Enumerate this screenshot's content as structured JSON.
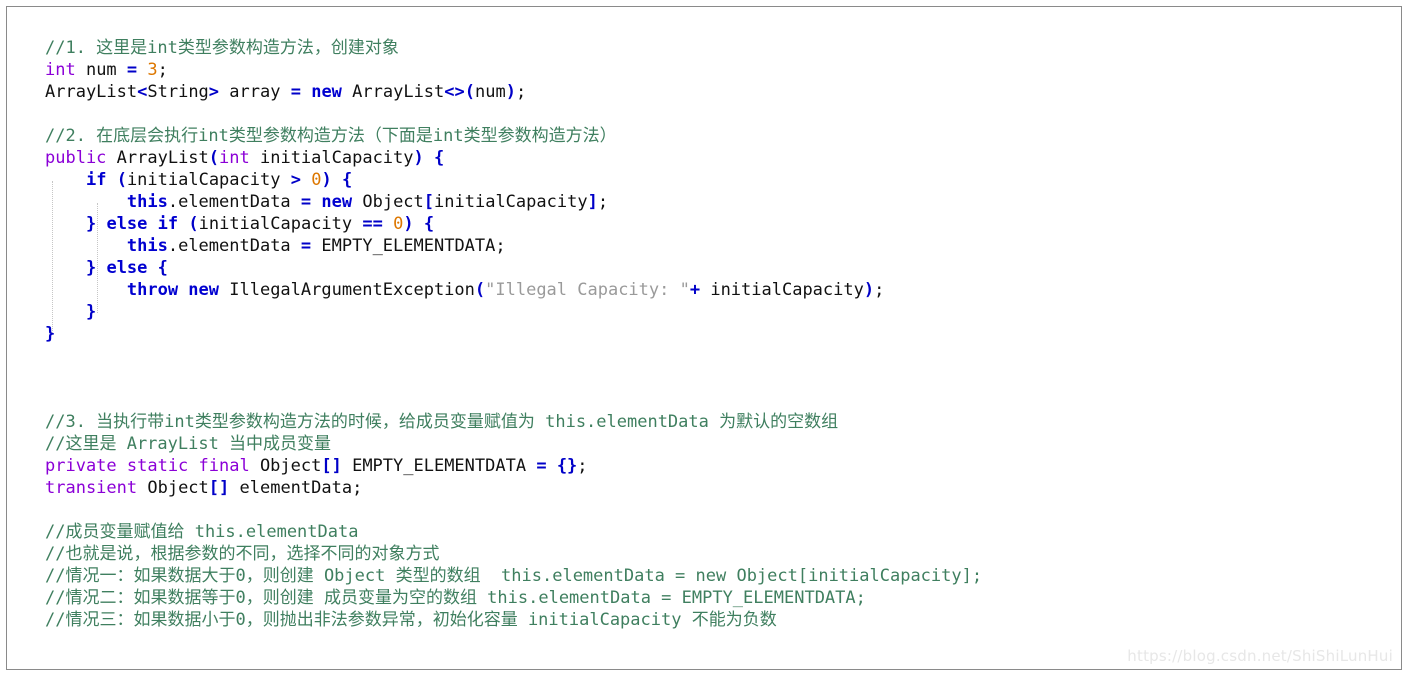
{
  "window": {
    "background_color": "#ffffff",
    "border_color": "#8a8a8a"
  },
  "syntax_colors": {
    "comment": "#3f7f5f",
    "keyword_purple": "#8b00d7",
    "keyword_blue_bold": "#0000d0",
    "number": "#dd7700",
    "string": "#9a9a9a",
    "operator": "#0000c8",
    "plain": "#111111"
  },
  "watermark": {
    "text": "https://blog.csdn.net/ShiShiLunHui",
    "color": "#e7e7e7"
  },
  "code": {
    "language": "java",
    "lines": [
      {
        "id": "l1",
        "tokens": [
          {
            "t": "//1. 这里是int类型参数构造方法，创建对象",
            "c": "cmt"
          }
        ]
      },
      {
        "id": "l2",
        "tokens": [
          {
            "t": "int",
            "c": "kwp"
          },
          {
            "t": " num ",
            "c": "pln"
          },
          {
            "t": "=",
            "c": "op"
          },
          {
            "t": " ",
            "c": "pln"
          },
          {
            "t": "3",
            "c": "num"
          },
          {
            "t": ";",
            "c": "pln"
          }
        ]
      },
      {
        "id": "l3",
        "tokens": [
          {
            "t": "ArrayList",
            "c": "pln"
          },
          {
            "t": "<",
            "c": "brk"
          },
          {
            "t": "String",
            "c": "pln"
          },
          {
            "t": ">",
            "c": "brk"
          },
          {
            "t": " array ",
            "c": "pln"
          },
          {
            "t": "=",
            "c": "op"
          },
          {
            "t": " ",
            "c": "pln"
          },
          {
            "t": "new",
            "c": "kwb"
          },
          {
            "t": " ArrayList",
            "c": "pln"
          },
          {
            "t": "<>(",
            "c": "brk"
          },
          {
            "t": "num",
            "c": "pln"
          },
          {
            "t": ")",
            "c": "brk"
          },
          {
            "t": ";",
            "c": "pln"
          }
        ]
      },
      {
        "id": "l4",
        "tokens": []
      },
      {
        "id": "l5",
        "tokens": [
          {
            "t": "//2. 在底层会执行int类型参数构造方法（下面是int类型参数构造方法）",
            "c": "cmt"
          }
        ]
      },
      {
        "id": "l6",
        "tokens": [
          {
            "t": "public",
            "c": "kwp"
          },
          {
            "t": " ArrayList",
            "c": "pln"
          },
          {
            "t": "(",
            "c": "brk"
          },
          {
            "t": "int",
            "c": "kwp"
          },
          {
            "t": " initialCapacity",
            "c": "pln"
          },
          {
            "t": ")",
            "c": "brk"
          },
          {
            "t": " ",
            "c": "pln"
          },
          {
            "t": "{",
            "c": "brk"
          }
        ]
      },
      {
        "id": "l7",
        "tokens": [
          {
            "t": "    ",
            "c": "pln"
          },
          {
            "t": "if",
            "c": "kwb"
          },
          {
            "t": " ",
            "c": "pln"
          },
          {
            "t": "(",
            "c": "brk"
          },
          {
            "t": "initialCapacity ",
            "c": "pln"
          },
          {
            "t": ">",
            "c": "op"
          },
          {
            "t": " ",
            "c": "pln"
          },
          {
            "t": "0",
            "c": "num"
          },
          {
            "t": ")",
            "c": "brk"
          },
          {
            "t": " ",
            "c": "pln"
          },
          {
            "t": "{",
            "c": "brk"
          }
        ]
      },
      {
        "id": "l8",
        "tokens": [
          {
            "t": "        ",
            "c": "pln"
          },
          {
            "t": "this",
            "c": "kwb"
          },
          {
            "t": ".elementData ",
            "c": "pln"
          },
          {
            "t": "=",
            "c": "op"
          },
          {
            "t": " ",
            "c": "pln"
          },
          {
            "t": "new",
            "c": "kwb"
          },
          {
            "t": " Object",
            "c": "pln"
          },
          {
            "t": "[",
            "c": "brk"
          },
          {
            "t": "initialCapacity",
            "c": "pln"
          },
          {
            "t": "]",
            "c": "brk"
          },
          {
            "t": ";",
            "c": "pln"
          }
        ]
      },
      {
        "id": "l9",
        "tokens": [
          {
            "t": "    ",
            "c": "pln"
          },
          {
            "t": "}",
            "c": "brk"
          },
          {
            "t": " ",
            "c": "pln"
          },
          {
            "t": "else if",
            "c": "kwb"
          },
          {
            "t": " ",
            "c": "pln"
          },
          {
            "t": "(",
            "c": "brk"
          },
          {
            "t": "initialCapacity ",
            "c": "pln"
          },
          {
            "t": "==",
            "c": "op"
          },
          {
            "t": " ",
            "c": "pln"
          },
          {
            "t": "0",
            "c": "num"
          },
          {
            "t": ")",
            "c": "brk"
          },
          {
            "t": " ",
            "c": "pln"
          },
          {
            "t": "{",
            "c": "brk"
          }
        ]
      },
      {
        "id": "l10",
        "tokens": [
          {
            "t": "        ",
            "c": "pln"
          },
          {
            "t": "this",
            "c": "kwb"
          },
          {
            "t": ".elementData ",
            "c": "pln"
          },
          {
            "t": "=",
            "c": "op"
          },
          {
            "t": " EMPTY_ELEMENTDATA;",
            "c": "pln"
          }
        ]
      },
      {
        "id": "l11",
        "tokens": [
          {
            "t": "    ",
            "c": "pln"
          },
          {
            "t": "}",
            "c": "brk"
          },
          {
            "t": " ",
            "c": "pln"
          },
          {
            "t": "else",
            "c": "kwb"
          },
          {
            "t": " ",
            "c": "pln"
          },
          {
            "t": "{",
            "c": "brk"
          }
        ]
      },
      {
        "id": "l12",
        "tokens": [
          {
            "t": "        ",
            "c": "pln"
          },
          {
            "t": "throw new",
            "c": "kwb"
          },
          {
            "t": " IllegalArgumentException",
            "c": "pln"
          },
          {
            "t": "(",
            "c": "brk"
          },
          {
            "t": "\"Illegal Capacity: \"",
            "c": "str"
          },
          {
            "t": "+",
            "c": "op"
          },
          {
            "t": " initialCapacity",
            "c": "pln"
          },
          {
            "t": ")",
            "c": "brk"
          },
          {
            "t": ";",
            "c": "pln"
          }
        ]
      },
      {
        "id": "l13",
        "tokens": [
          {
            "t": "    ",
            "c": "pln"
          },
          {
            "t": "}",
            "c": "brk"
          }
        ]
      },
      {
        "id": "l14",
        "tokens": [
          {
            "t": "}",
            "c": "brk"
          }
        ]
      },
      {
        "id": "l15",
        "tokens": []
      },
      {
        "id": "l16",
        "tokens": []
      },
      {
        "id": "l17",
        "tokens": []
      },
      {
        "id": "l18",
        "tokens": [
          {
            "t": "//3. 当执行带int类型参数构造方法的时候，给成员变量赋值为 this.elementData 为默认的空数组",
            "c": "cmt"
          }
        ]
      },
      {
        "id": "l19",
        "tokens": [
          {
            "t": "//这里是 ArrayList 当中成员变量",
            "c": "cmt"
          }
        ]
      },
      {
        "id": "l20",
        "tokens": [
          {
            "t": "private static final",
            "c": "kwp"
          },
          {
            "t": " Object",
            "c": "pln"
          },
          {
            "t": "[]",
            "c": "brk"
          },
          {
            "t": " EMPTY_ELEMENTDATA ",
            "c": "pln"
          },
          {
            "t": "=",
            "c": "op"
          },
          {
            "t": " ",
            "c": "pln"
          },
          {
            "t": "{}",
            "c": "brk"
          },
          {
            "t": ";",
            "c": "pln"
          }
        ]
      },
      {
        "id": "l21",
        "tokens": [
          {
            "t": "transient",
            "c": "kwp"
          },
          {
            "t": " Object",
            "c": "pln"
          },
          {
            "t": "[]",
            "c": "brk"
          },
          {
            "t": " elementData;",
            "c": "pln"
          }
        ]
      },
      {
        "id": "l22",
        "tokens": []
      },
      {
        "id": "l23",
        "tokens": [
          {
            "t": "//成员变量赋值给 this.elementData",
            "c": "cmt"
          }
        ]
      },
      {
        "id": "l24",
        "tokens": [
          {
            "t": "//也就是说，根据参数的不同，选择不同的对象方式",
            "c": "cmt"
          }
        ]
      },
      {
        "id": "l25",
        "tokens": [
          {
            "t": "//情况一：如果数据大于0，则创建 Object 类型的数组  this.elementData = new Object[initialCapacity];",
            "c": "cmt"
          }
        ]
      },
      {
        "id": "l26",
        "tokens": [
          {
            "t": "//情况二：如果数据等于0，则创建 成员变量为空的数组 this.elementData = EMPTY_ELEMENTDATA;",
            "c": "cmt"
          }
        ]
      },
      {
        "id": "l27",
        "tokens": [
          {
            "t": "//情况三：如果数据小于0，则抛出非法参数异常，初始化容量 initialCapacity 不能为负数",
            "c": "cmt"
          }
        ]
      }
    ]
  }
}
